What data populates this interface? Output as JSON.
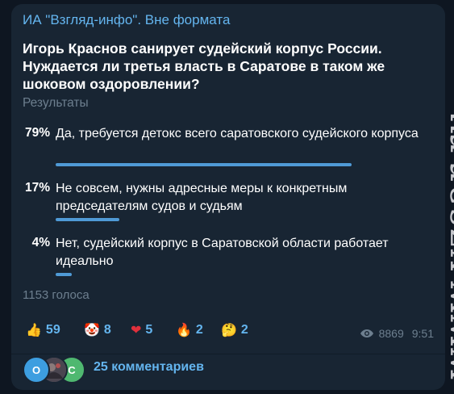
{
  "channel_name": "ИА \"Взгляд-инфо\". Вне формата",
  "poll": {
    "question": "Игорь Краснов санирует судейский корпус России. Нуждается ли третья власть в Саратове в таком же шоковом оздоровлении?",
    "results_label": "Результаты",
    "options": [
      {
        "percent_label": "79%",
        "text": "Да, требуется детокс всего саратовского судейского корпуса",
        "fraction": 0.79
      },
      {
        "percent_label": "17%",
        "text": "Не совсем, нужны адресные меры к конкретным председателям судов и судьям",
        "fraction": 0.17
      },
      {
        "percent_label": "4%",
        "text": "Нет, судейский корпус в Саратовской области работает идеально",
        "fraction": 0.04
      }
    ],
    "votes_label": "1153 голоса",
    "bar_color": "#4f9ad6"
  },
  "reactions": [
    {
      "emoji": "👍",
      "icon": "thumbs-up-icon",
      "count": "59"
    },
    {
      "emoji": "🤡",
      "icon": "clown-icon",
      "count": "8"
    },
    {
      "emoji": "❤",
      "icon": "heart-icon",
      "count": "5"
    },
    {
      "emoji": "🔥",
      "icon": "fire-icon",
      "count": "2"
    },
    {
      "emoji": "🤔",
      "icon": "thinking-face-icon",
      "count": "2"
    }
  ],
  "views": "8869",
  "time": "9:51",
  "comments": {
    "label": "25 комментариев",
    "avatars": [
      {
        "initial": "О",
        "color": "#3d9ee0"
      },
      {
        "initial": "",
        "color": "#5a5a6a"
      },
      {
        "initial": "С",
        "color": "#4fb870"
      }
    ]
  },
  "watermark": "www.vzsar.ru",
  "colors": {
    "background": "#0e1621",
    "bubble": "#182533",
    "accent": "#64b5ef",
    "muted": "#6d7f8f"
  }
}
